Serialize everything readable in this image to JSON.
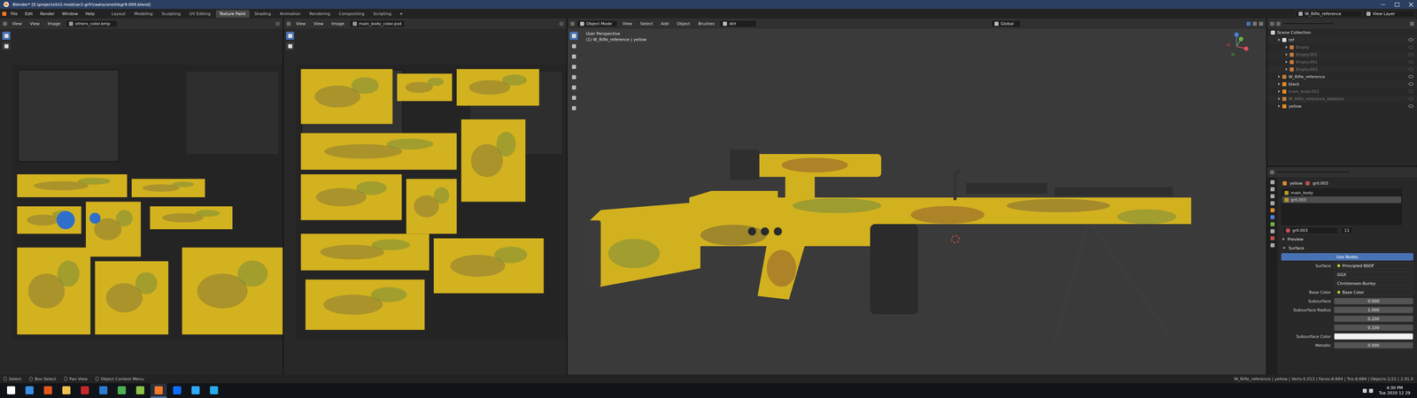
{
  "window": {
    "title": "Blender* [E:\\projects\\hl2-mods\\ar2-grfr\\raw\\scene\\hkgr9-009.blend]"
  },
  "menus": [
    "File",
    "Edit",
    "Render",
    "Window",
    "Help"
  ],
  "workspaces": [
    {
      "label": "Layout",
      "selected": false
    },
    {
      "label": "Modeling",
      "selected": false
    },
    {
      "label": "Sculpting",
      "selected": false
    },
    {
      "label": "UV Editing",
      "selected": false
    },
    {
      "label": "Texture Paint",
      "selected": true
    },
    {
      "label": "Shading",
      "selected": false
    },
    {
      "label": "Animation",
      "selected": false
    },
    {
      "label": "Rendering",
      "selected": false
    },
    {
      "label": "Compositing",
      "selected": false
    },
    {
      "label": "Scripting",
      "selected": false
    }
  ],
  "add_workspace": "+",
  "scene": "W_Rifle_reference",
  "view_layer": "View Layer",
  "image_editors": [
    {
      "menus": [
        "View",
        "View",
        "Image"
      ],
      "image": "others_color.bmp"
    },
    {
      "menus": [
        "View",
        "View",
        "Image"
      ],
      "image": "main_body_color.psd"
    }
  ],
  "viewport": {
    "mode": "Object Mode",
    "menus": [
      "View",
      "Select",
      "Add",
      "Object",
      "Brushes"
    ],
    "brush": "dirt",
    "orientation": "Global",
    "overlay_title": "User Perspective",
    "overlay_object": "(1) W_Rifle_reference | yellow"
  },
  "outliner": {
    "root": "Scene Collection",
    "items": [
      {
        "name": "ref",
        "depth": 0,
        "hidden": false,
        "kind": "collection"
      },
      {
        "name": "Empty",
        "depth": 1,
        "hidden": true,
        "kind": "empty"
      },
      {
        "name": "Empty.001",
        "depth": 1,
        "hidden": true,
        "kind": "empty"
      },
      {
        "name": "Empty.002",
        "depth": 1,
        "hidden": true,
        "kind": "empty"
      },
      {
        "name": "Empty.003",
        "depth": 1,
        "hidden": true,
        "kind": "empty"
      },
      {
        "name": "W_Rifle_reference",
        "depth": 0,
        "hidden": false,
        "kind": "armature"
      },
      {
        "name": "black",
        "depth": 0,
        "hidden": false,
        "kind": "mesh"
      },
      {
        "name": "main_body.002",
        "depth": 0,
        "hidden": true,
        "kind": "mesh"
      },
      {
        "name": "W_Rifle_reference_skeleton",
        "depth": 0,
        "hidden": true,
        "kind": "armature"
      },
      {
        "name": "yellow",
        "depth": 0,
        "hidden": false,
        "kind": "mesh"
      }
    ]
  },
  "properties": {
    "object": "yellow",
    "material": "grll.003",
    "slots": [
      {
        "name": "main_body",
        "selected": false
      },
      {
        "name": "grll.003",
        "selected": true
      }
    ],
    "material_field": "grll.003",
    "users": "11",
    "sections": [
      {
        "label": "Preview",
        "expanded": false
      },
      {
        "label": "Surface",
        "expanded": true
      }
    ],
    "use_nodes": "Use Nodes",
    "rows": [
      {
        "label": "Surface",
        "value": "Principled BSDF",
        "kind": "link"
      },
      {
        "label": "",
        "value": "GGX",
        "kind": "dropdown"
      },
      {
        "label": "",
        "value": "Christensen-Burley",
        "kind": "dropdown"
      },
      {
        "label": "Base Color",
        "value": "Base Color",
        "kind": "link"
      },
      {
        "label": "Subsurface",
        "value": "0.000",
        "kind": "number"
      },
      {
        "label": "Subsurface Radius",
        "value": "1.000",
        "kind": "number"
      },
      {
        "label": "",
        "value": "0.200",
        "kind": "number"
      },
      {
        "label": "",
        "value": "0.100",
        "kind": "number"
      },
      {
        "label": "Subsurface Color",
        "value": "",
        "kind": "color"
      },
      {
        "label": "Metallic",
        "value": "0.000",
        "kind": "number"
      }
    ]
  },
  "status_bar": {
    "hints": [
      "Select",
      "Box Select",
      "Pan View",
      "Object Context Menu"
    ],
    "stats": "W_Rifle_reference | yellow | Verts:5,013 | Faces:8,684 | Tris:8,684 | Objects:1/22 | 2.91.0"
  },
  "taskbar": {
    "apps": [
      {
        "color": "#3a8ee6",
        "active": false
      },
      {
        "color": "#e2571e",
        "active": false
      },
      {
        "color": "#f2c14e",
        "active": false
      },
      {
        "color": "#c62828",
        "active": false
      },
      {
        "color": "#2b7cd3",
        "active": false
      },
      {
        "color": "#4caf50",
        "active": false
      },
      {
        "color": "#8bc34a",
        "active": false
      },
      {
        "color": "#f5792a",
        "active": true
      },
      {
        "color": "#0d6efd",
        "active": false
      },
      {
        "color": "#31a8ff",
        "active": false
      },
      {
        "color": "#29a9ea",
        "active": false
      }
    ],
    "time": "4:30 PM",
    "date": "Tue 2020 12 29"
  }
}
